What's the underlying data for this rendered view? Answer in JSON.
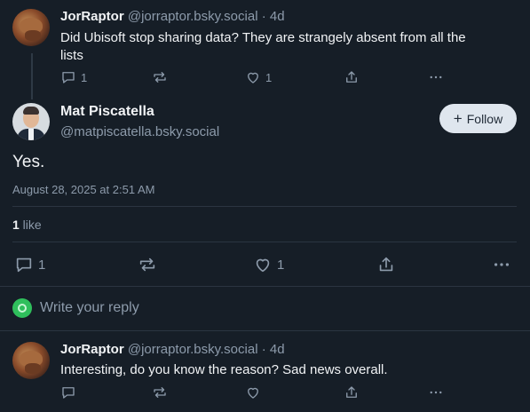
{
  "parent_post": {
    "author": "JorRaptor",
    "handle": "@jorraptor.bsky.social",
    "separator": "·",
    "age": "4d",
    "text_line1": "Did Ubisoft stop sharing data? They are strangely absent from all the",
    "text_line2": "lists",
    "reply_count": "1",
    "like_count": "1"
  },
  "focus_post": {
    "author": "Mat Piscatella",
    "handle": "@matpiscatella.bsky.social",
    "follow_label": "Follow",
    "text": "Yes.",
    "timestamp": "August 28, 2025 at 2:51 AM",
    "likes_count": "1",
    "likes_label": " like",
    "reply_count": "1",
    "like_count": "1"
  },
  "reply_composer": {
    "placeholder": "Write your reply"
  },
  "reply_post": {
    "author": "JorRaptor",
    "handle": "@jorraptor.bsky.social",
    "separator": "·",
    "age": "4d",
    "text": "Interesting, do you know the reason? Sad news overall."
  },
  "icons": [
    "reply-icon",
    "repost-icon",
    "like-icon",
    "share-icon",
    "more-icon",
    "plus-icon"
  ],
  "colors": {
    "background": "#161e27",
    "muted": "#8d9bab",
    "follow_bg": "#dfe6ee",
    "composer_avatar": "#2fbf5c"
  }
}
